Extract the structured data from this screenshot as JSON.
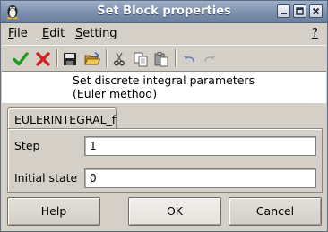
{
  "window": {
    "title": "Set Block properties"
  },
  "menubar": {
    "items": [
      {
        "label": "File",
        "accel": "F",
        "rest": "ile"
      },
      {
        "label": "Edit",
        "accel": "E",
        "rest": "dit"
      },
      {
        "label": "Setting",
        "accel": "S",
        "rest": "etting"
      },
      {
        "label": "?",
        "accel": "?",
        "rest": ""
      }
    ]
  },
  "toolbar": {
    "icons": [
      "check-icon",
      "cross-icon",
      "save-icon",
      "open-folder-icon",
      "cut-icon",
      "copy-icon",
      "paste-icon",
      "undo-icon",
      "redo-icon"
    ]
  },
  "description": {
    "line1": "Set discrete integral parameters",
    "line2": "(Euler method)"
  },
  "tabs": [
    {
      "label": "EULERINTEGRAL_f"
    }
  ],
  "fields": [
    {
      "label": "Step",
      "value": "1"
    },
    {
      "label": "Initial state",
      "value": "0"
    }
  ],
  "buttons": {
    "help": "Help",
    "ok": "OK",
    "cancel": "Cancel"
  },
  "colors": {
    "titlebar": "#7c8fad",
    "accept_green": "#1e9a1e",
    "reject_red": "#d42020"
  }
}
